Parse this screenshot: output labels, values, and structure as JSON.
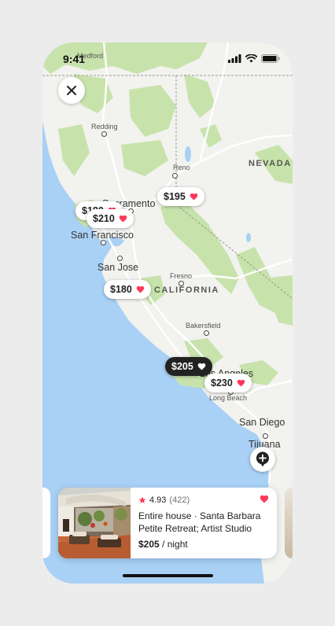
{
  "status_bar": {
    "time": "9:41"
  },
  "map": {
    "labels": {
      "medford": "Medford",
      "redding": "Redding",
      "reno": "Reno",
      "nevada": "NEVADA",
      "sacramento": "Sacramento",
      "san_francisco": "San Francisco",
      "san_jose": "San Jose",
      "fresno": "Fresno",
      "california": "CALIFORNIA",
      "bakersfield": "Bakersfield",
      "los_angeles": "Los Angeles",
      "long_beach": "Long Beach",
      "san_diego": "San Diego",
      "tijuana": "Tijuana"
    },
    "price_pins": [
      {
        "price": "$195",
        "saved": true,
        "selected": false
      },
      {
        "price": "$180",
        "saved": true,
        "selected": false
      },
      {
        "price": "$210",
        "saved": true,
        "selected": false
      },
      {
        "price": "$180",
        "saved": true,
        "selected": false
      },
      {
        "price": "$205",
        "saved": false,
        "selected": true
      },
      {
        "price": "$230",
        "saved": true,
        "selected": false
      }
    ]
  },
  "listing_card": {
    "rating": "4.93",
    "reviews": "(422)",
    "title_line1": "Entire house · Santa Barbara",
    "title_line2": "Petite Retreat; Artist Studio",
    "price": "$205",
    "price_unit": "/ night",
    "saved": true
  },
  "colors": {
    "ocean": "#a9d0f5",
    "land": "#f2f2ef",
    "park": "#c7e3ab",
    "wishlist": "#ff385c",
    "selected_pin": "#222222"
  },
  "icons": [
    "close-icon",
    "heart-icon",
    "star-icon",
    "add-location-icon",
    "signal-icon",
    "wifi-icon",
    "battery-icon"
  ]
}
